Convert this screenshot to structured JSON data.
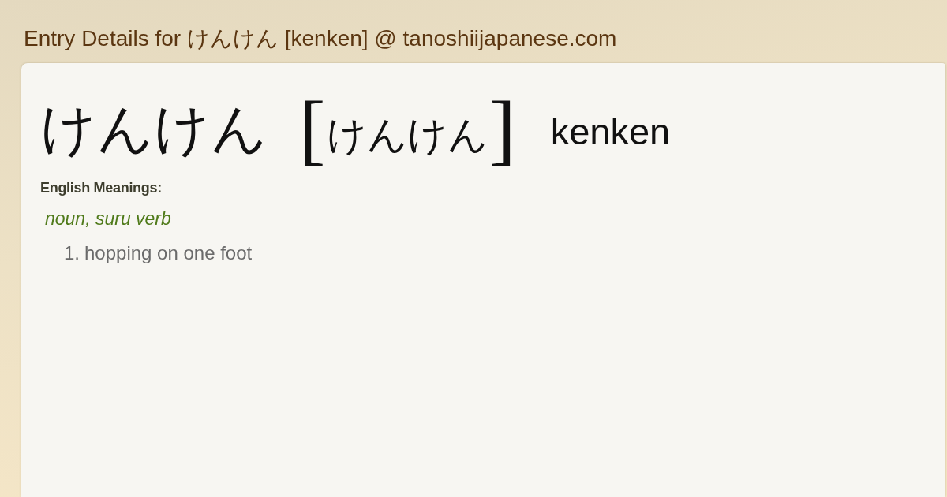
{
  "page_title": "Entry Details for けんけん [kenken] @ tanoshiijapanese.com",
  "entry": {
    "headword": "けんけん",
    "reading": {
      "open_bracket": "[",
      "text": "けんけん",
      "close_bracket": "]"
    },
    "romaji": "kenken"
  },
  "meanings": {
    "heading": "English Meanings:",
    "part_of_speech": "noun, suru verb",
    "senses": [
      {
        "number": "1.",
        "text": "hopping on one foot"
      }
    ]
  }
}
